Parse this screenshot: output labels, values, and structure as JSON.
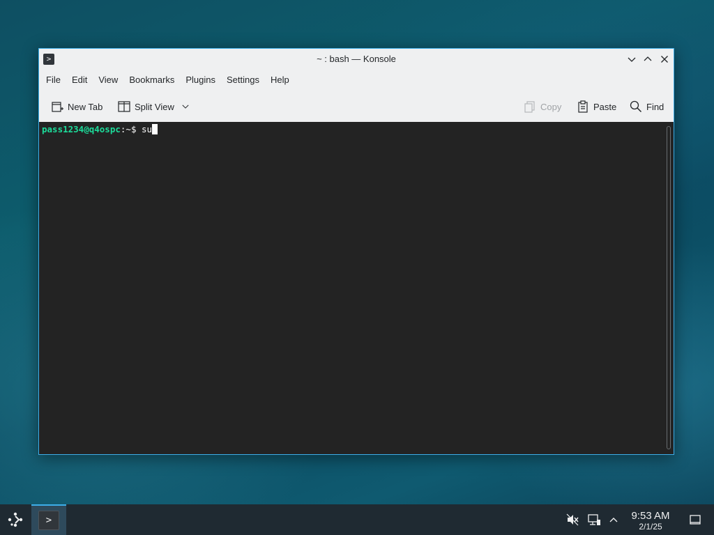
{
  "window": {
    "title": "~ : bash — Konsole",
    "app_icon": "terminal-icon"
  },
  "menubar": {
    "items": [
      "File",
      "Edit",
      "View",
      "Bookmarks",
      "Plugins",
      "Settings",
      "Help"
    ]
  },
  "toolbar": {
    "new_tab": "New Tab",
    "split_view": "Split View",
    "copy": "Copy",
    "paste": "Paste",
    "find": "Find"
  },
  "terminal": {
    "prompt_user": "pass1234@q4ospc",
    "prompt_path": ":~$ ",
    "command": "su"
  },
  "taskbar": {
    "time": "9:53 AM",
    "date": "2/1/25"
  },
  "colors": {
    "accent": "#3daee9",
    "prompt_green": "#1cdc9a",
    "terminal_bg": "#232323",
    "taskbar_bg": "#1f2a32"
  }
}
